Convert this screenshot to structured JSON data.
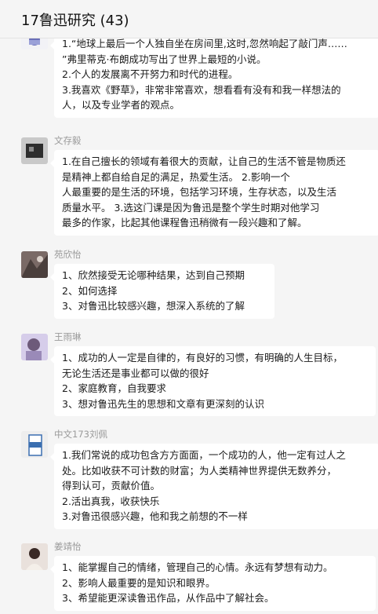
{
  "header": {
    "title": "17鲁迅研究 (43)"
  },
  "messages": [
    {
      "sender": "",
      "lines": [
        "1.“地球上最后一个人独自坐在房间里,这时,忽然响起了敲门声……",
        "  ”弗里蒂克·布朗成功写出了世界上最短的小说。",
        "2.个人的发展离不开努力和时代的进程。",
        "3.我喜欢《野草》，非常非常喜欢，想看看有没有和我一样想法的",
        "人，以及专业学者的观点。"
      ]
    },
    {
      "sender": "文存毅",
      "lines": [
        "1.在自己擅长的领域有着很大的贡献，让自己的生活不管是物质还",
        "是精神上都自给自足的满足，热爱生活。                 2.影响一个",
        "人最重要的是生活的环境，包括学习环境，生存状态，以及生活",
        "质量水平。          3.选这门课是因为鲁迅是整个学生时期对他学习",
        "最多的作家，比起其他课程鲁迅稍微有一段兴趣和了解。"
      ]
    },
    {
      "sender": "苑欣怡",
      "lines": [
        "1、欣然接受无论哪种结果，达到自己预期",
        "2、如何选择",
        "3、对鲁迅比较感兴趣，想深入系统的了解"
      ]
    },
    {
      "sender": "王雨琳",
      "lines": [
        "1、成功的人一定是自律的，有良好的习惯，有明确的人生目标，",
        "无论生活还是事业都可以做的很好",
        "2、家庭教育，自我要求",
        "3、想对鲁迅先生的思想和文章有更深刻的认识"
      ]
    },
    {
      "sender": "中文173刘佩",
      "lines": [
        "1.我们常说的成功包含方方面面，一个成功的人，他一定有过人之",
        "处。比如收获不可计数的财富；为人类精神世界提供无数养分，",
        "得到认可，贡献价值。",
        "2.活出真我，收获快乐",
        "3.对鲁迅很感兴趣，他和我之前想的不一样"
      ]
    },
    {
      "sender": "姜靖怡",
      "lines": [
        "1、能掌握自己的情绪，管理自己的心情。永远有梦想有动力。",
        "2、影响人最重要的是知识和眼界。",
        "3、希望能更深读鲁迅作品，从作品中了解社会。"
      ]
    }
  ]
}
